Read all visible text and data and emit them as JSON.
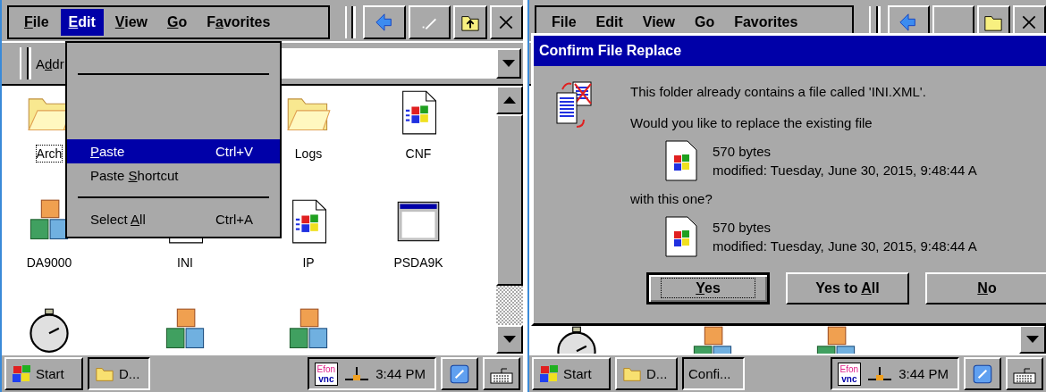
{
  "screens": [
    {
      "menu_bar": [
        {
          "key": "F",
          "post": "ile",
          "selected": false
        },
        {
          "key": "E",
          "post": "dit",
          "selected": true
        },
        {
          "key": "V",
          "post": "iew",
          "selected": false
        },
        {
          "key": "G",
          "post": "o",
          "selected": false
        },
        {
          "pre": "F",
          "key": "a",
          "post": "vorites",
          "selected": false
        }
      ],
      "address_label": {
        "pre": "A",
        "key": "d",
        "post": "dr"
      },
      "edit_menu": [
        {
          "kind": "separator"
        },
        {
          "kind": "item",
          "key": "P",
          "post": "aste",
          "shortcut": "Ctrl+V",
          "selected": true
        },
        {
          "kind": "item",
          "pre": "Paste ",
          "key": "S",
          "post": "hortcut",
          "selected": false
        },
        {
          "kind": "separator"
        },
        {
          "kind": "item",
          "pre": "Select ",
          "key": "A",
          "post": "ll",
          "shortcut": "Ctrl+A",
          "selected": false
        }
      ],
      "icons": [
        {
          "kind": "folder",
          "label": "Arch",
          "selected": true
        },
        {
          "kind": "folder",
          "label": "Logs",
          "selected": false
        },
        {
          "kind": "winfile",
          "label": "CNF",
          "selected": false
        },
        {
          "kind": "blocks",
          "label": "DA9000",
          "selected": false
        },
        {
          "kind": "winfile",
          "label": "INI",
          "selected": false
        },
        {
          "kind": "winfile",
          "label": "IP",
          "selected": false
        },
        {
          "kind": "window",
          "label": "PSDA9K",
          "selected": false
        },
        {
          "kind": "stopwatch"
        },
        {
          "kind": "blocks"
        },
        {
          "kind": "blocks"
        }
      ],
      "taskbar": {
        "start": "Start",
        "tasks": [
          {
            "kind": "folder",
            "label": "D...",
            "selected": true
          }
        ],
        "tray": {
          "vnc": [
            "Efon",
            "vnc"
          ],
          "clock": "3:44 PM"
        }
      }
    },
    {
      "menu_bar": [
        {
          "label": "File",
          "selected": false
        },
        {
          "label": "Edit",
          "selected": false
        },
        {
          "label": "View",
          "selected": false
        },
        {
          "label": "Go",
          "selected": false
        },
        {
          "label": "Favorites",
          "selected": false
        }
      ],
      "icons": [
        {
          "kind": "stopwatch"
        },
        {
          "kind": "blocks"
        },
        {
          "kind": "blocks"
        }
      ],
      "dialog": {
        "title": "Confirm File Replace",
        "message": "This folder already contains a file called 'INI.XML'.",
        "question": "Would you like to replace the existing file",
        "existing": {
          "size": "570 bytes",
          "modified": "modified: Tuesday, June 30, 2015, 9:48:44 A"
        },
        "connector": "with this one?",
        "replacement": {
          "size": "570 bytes",
          "modified": "modified: Tuesday, June 30, 2015, 9:48:44 A"
        },
        "buttons": [
          {
            "key": "Y",
            "post": "es",
            "focused": true
          },
          {
            "pre": "Yes to ",
            "key": "A",
            "post": "ll",
            "focused": false
          },
          {
            "key": "N",
            "post": "o",
            "focused": false
          }
        ]
      },
      "taskbar": {
        "start": "Start",
        "tasks": [
          {
            "kind": "folder",
            "label": "D...",
            "selected": false
          },
          {
            "kind": "plain",
            "label": "Confi...",
            "selected": true
          }
        ],
        "tray": {
          "vnc": [
            "Efon",
            "vnc"
          ],
          "clock": "3:44 PM"
        }
      }
    }
  ]
}
